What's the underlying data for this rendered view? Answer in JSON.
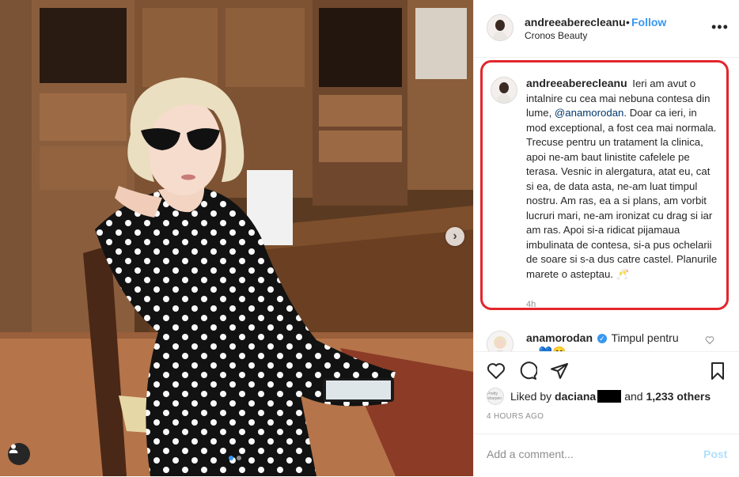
{
  "post": {
    "author": "andreeaberecleanu",
    "follow_separator": "•",
    "follow_label": "Follow",
    "location": "Cronos Beauty",
    "more_label": "•••"
  },
  "caption": {
    "author": "andreeaberecleanu",
    "text_before_mention": "Ieri am avut o intalnire cu cea mai nebuna contesa din lume,",
    "mention": "@anamorodan",
    "text_after_mention": ". Doar ca ieri, in mod exceptional, a fost cea mai normala. Trecuse pentru un tratament la clinica, apoi ne-am baut linistite cafelele pe terasa. Vesnic in alergatura, atat eu, cat si ea, de data asta, ne-am luat timpul nostru. Am ras, ea a si plans, am vorbit lucruri mari, ne-am ironizat cu drag si iar am ras. Apoi si-a ridicat pijamaua imbulinata de contesa, si-a pus ochelarii de soare si s-a dus catre castel. Planurile marete o asteptau.",
    "emoji": "🥂",
    "age": "4h"
  },
  "comment": {
    "author": "anamorodan",
    "verified_mark": "✓",
    "text": "Timpul pentru",
    "text_overflow": "... 💙😊"
  },
  "likes": {
    "prefix": "Liked by",
    "first_liker": "daciana",
    "middle": "and",
    "others": "1,233 others",
    "mini_avatar_text": "Pretty sharpen"
  },
  "timestamp": "4 HOURS AGO",
  "add_comment": {
    "placeholder": "Add a comment...",
    "post_label": "Post"
  },
  "carousel": {
    "next_label": "›",
    "dots": 2,
    "active_dot": 1
  },
  "colors": {
    "accent_blue": "#3897f0",
    "highlight_red": "#e3262c",
    "text": "#262626",
    "muted": "#8e8e8e"
  },
  "icons": [
    "heart-icon",
    "comment-icon",
    "share-icon",
    "bookmark-icon",
    "more-icon",
    "user-tag-icon",
    "chevron-right-icon",
    "verified-icon"
  ]
}
